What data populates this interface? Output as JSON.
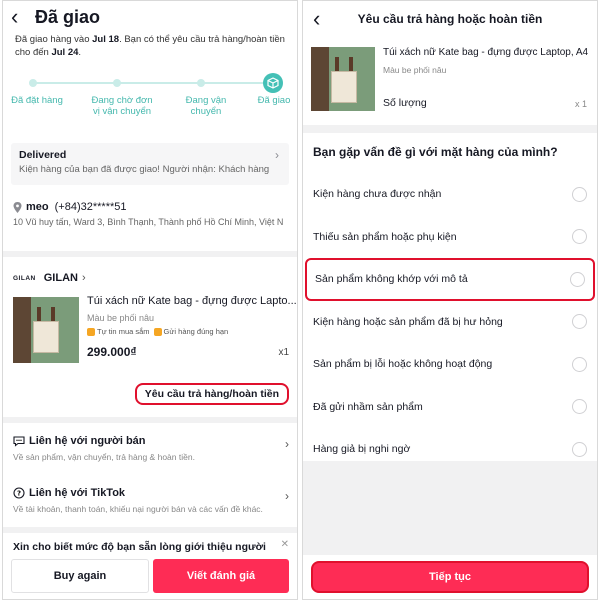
{
  "left": {
    "title": "Đã giao",
    "notice": {
      "part1": "Đã giao hàng vào ",
      "date1": "Jul 18",
      "part2": ". Bạn có thể yêu cầu trả hàng/hoàn tiền cho đến ",
      "date2": "Jul 24",
      "part3": "."
    },
    "steps": [
      "Đã đặt hàng",
      "Đang chờ đơn vị vận chuyển",
      "Đang vận chuyển",
      "Đã giao"
    ],
    "delivered": {
      "heading": "Delivered",
      "detail": "Kiện hàng của bạn đã được giao! Người nhận: Khách hàng"
    },
    "address": {
      "name": "meo",
      "phone": "(+84)32*****51",
      "line": "10 Vũ huy tấn, Ward 3, Bình Thạnh, Thành phố Hồ Chí Minh, Việt N"
    },
    "shop": {
      "logo": "GILAN",
      "name": "GILAN"
    },
    "product": {
      "name": "Túi xách nữ Kate bag - đựng được Lapto...",
      "variant": "Màu be phối nâu",
      "tag1": "Tự tin mua sắm",
      "tag2": "Gửi hàng đúng hạn",
      "price": "299.000₫",
      "qty": "x1"
    },
    "request_button": "Yêu cầu trả hàng/hoàn tiền",
    "contact_seller": {
      "title": "Liên hệ với người bán",
      "sub": "Về sản phẩm, vận chuyển, trả hàng & hoàn tiền."
    },
    "contact_tiktok": {
      "title": "Liên hệ với TikTok",
      "sub": "Về tài khoản, thanh toán, khiếu nại người bán và các vấn đề khác."
    },
    "rate_prompt": "Xin cho biết mức độ bạn sẵn lòng giới thiệu người",
    "buy_again": "Buy again",
    "write_review": "Viết đánh giá"
  },
  "right": {
    "title": "Yêu cầu trả hàng hoặc hoàn tiền",
    "product": {
      "name": "Túi xách nữ Kate bag - đựng được Laptop, A4",
      "variant": "Màu be phối nâu",
      "qty_label": "Số lượng",
      "qty_value": "x 1"
    },
    "question": "Bạn gặp vấn đề gì với mặt hàng của mình?",
    "options": [
      "Kiện hàng chưa được nhận",
      "Thiếu sản phẩm hoặc phụ kiện",
      "Sản phẩm không khớp với mô tả",
      "Kiện hàng hoặc sản phẩm đã bị hư hỏng",
      "Sản phẩm bị lỗi hoặc không hoạt động",
      "Đã gửi nhầm sản phẩm",
      "Hàng giả bị nghi ngờ"
    ],
    "continue_button": "Tiếp tục"
  },
  "colors": {
    "accent": "#fe2c55",
    "highlight": "#e0102d",
    "teal": "#44c0b6"
  },
  "icons": [
    "back-icon",
    "package-icon",
    "chevron-right-icon",
    "location-pin-icon",
    "chat-icon",
    "help-icon",
    "close-icon",
    "radio-icon"
  ]
}
